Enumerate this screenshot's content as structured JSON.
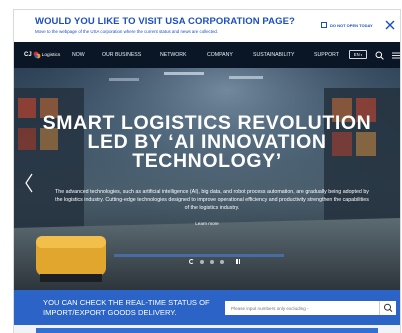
{
  "banner": {
    "title": "WOULD YOU LIKE TO VISIT USA CORPORATION PAGE?",
    "subtitle": "Move to the webpage of the USA corporation where the current status and news are collected.",
    "do_not_open_label": "DO NOT OPEN TODAY",
    "close_icon": "close-icon"
  },
  "nav": {
    "logo_cj": "CJ",
    "logo_text": "Logistics",
    "items": [
      "NOW",
      "OUR BUSINESS",
      "NETWORK",
      "COMPANY",
      "SUSTAINABILITY",
      "SUPPORT"
    ],
    "lang": "EN",
    "search_icon": "search-icon",
    "menu_icon": "menu-icon"
  },
  "hero": {
    "title_lines": [
      "SMART LOGISTICS REVOLUTION",
      "LED BY ‘AI INNOVATION",
      "TECHNOLOGY’"
    ],
    "desc_lines": [
      "The advanced technologies, such as artificial intelligence (AI), big data, and robot process automation, are gradually being adopted by",
      "the logistics industry. Cutting-edge technologies designed to improve operational efficiency and productivity strengthen the capabilities",
      "of the logistics industry."
    ],
    "learn_more": "Learn more",
    "slides_total": 4,
    "active_slide": 1
  },
  "track": {
    "text_lines": [
      "YOU CAN CHECK THE REAL-TIME STATUS OF",
      "IMPORT/EXPORT GOODS DELIVERY."
    ],
    "placeholder": "Please input numbers only excluding -",
    "value": ""
  },
  "colors": {
    "brand_blue": "#1b4fbf",
    "track_blue": "#2b63c6",
    "logo_red": "#e4262c",
    "logo_orange": "#f39a1d"
  }
}
